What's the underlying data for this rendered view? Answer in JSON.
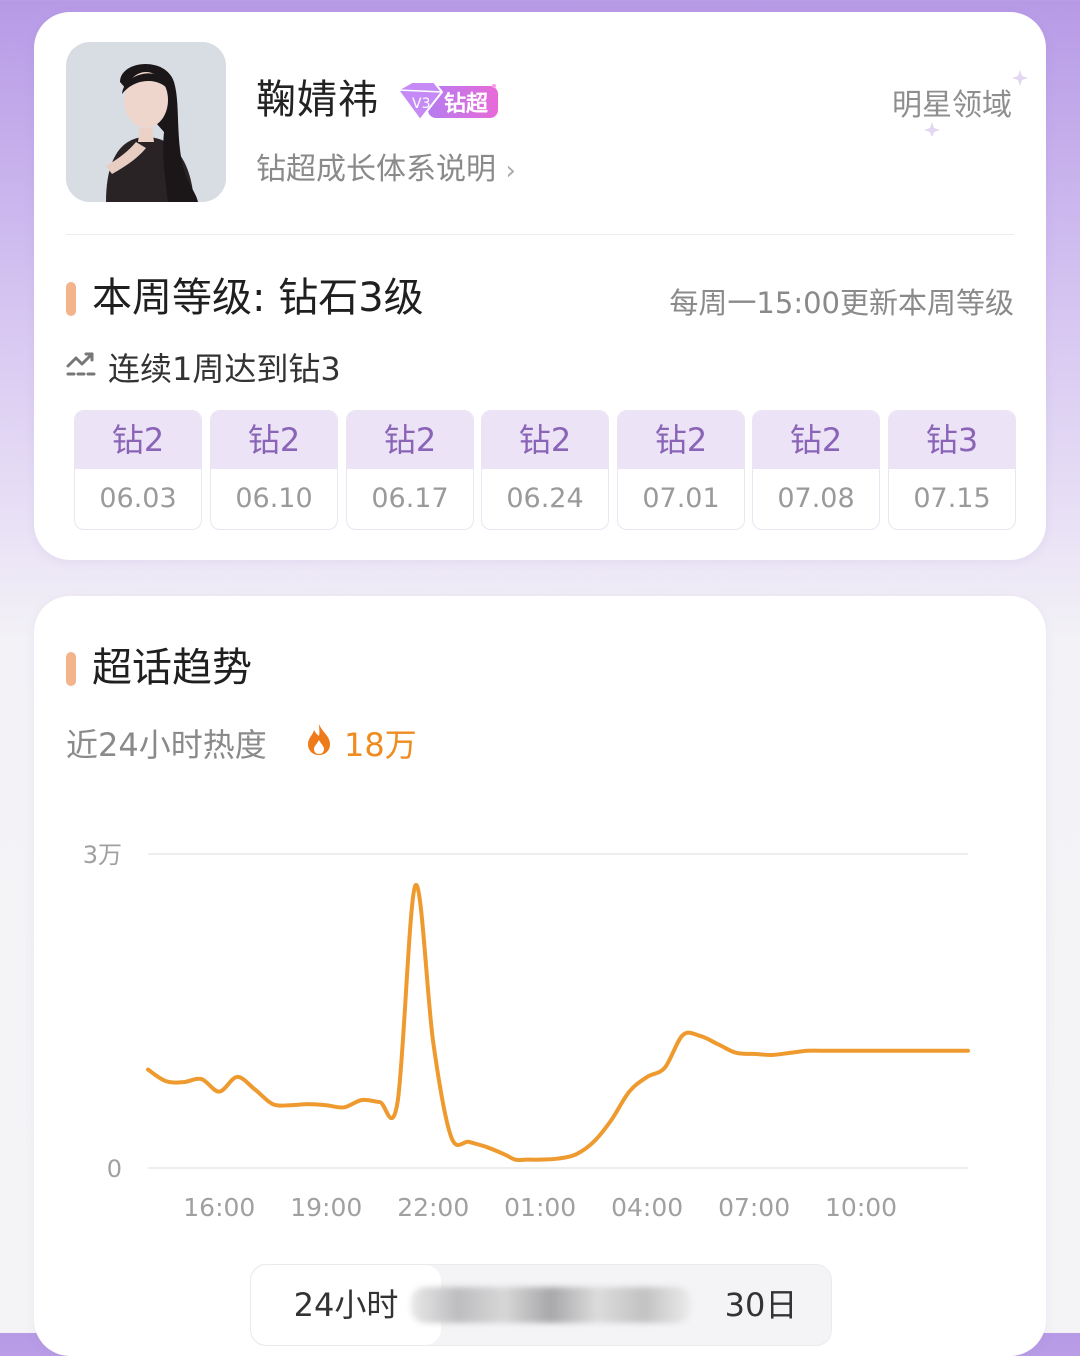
{
  "profile": {
    "name": "鞠婧祎",
    "badge": "钻超",
    "growth_link": "钻超成长体系说明",
    "domain_tag": "明星领域"
  },
  "level": {
    "title": "本周等级: 钻石3级",
    "update_note": "每周一15:00更新本周等级",
    "streak": "连续1周达到钻3",
    "weeks": [
      {
        "level": "钻2",
        "date": "06.03"
      },
      {
        "level": "钻2",
        "date": "06.10"
      },
      {
        "level": "钻2",
        "date": "06.17"
      },
      {
        "level": "钻2",
        "date": "06.24"
      },
      {
        "level": "钻2",
        "date": "07.01"
      },
      {
        "level": "钻2",
        "date": "07.08"
      },
      {
        "level": "钻3",
        "date": "07.15"
      }
    ]
  },
  "trend": {
    "title": "超话趋势",
    "heat_label": "近24小时热度",
    "heat_value": "18万"
  },
  "chart_data": {
    "type": "line",
    "y_tick_labels": [
      "0",
      "3万"
    ],
    "ylim": [
      0,
      30000
    ],
    "x_tick_labels": [
      "16:00",
      "19:00",
      "22:00",
      "01:00",
      "04:00",
      "07:00",
      "10:00"
    ],
    "x_hours": [
      14,
      14.5,
      15,
      15.5,
      16,
      16.5,
      17,
      17.5,
      18,
      18.5,
      19,
      19.5,
      20,
      20.5,
      21,
      21.5,
      22,
      22.5,
      23,
      23.5,
      24,
      24.3,
      24.6,
      25,
      25.5,
      26,
      26.5,
      27,
      27.5,
      28,
      28.5,
      29,
      29.5,
      30,
      30.5,
      31,
      31.5,
      32,
      32.5,
      33,
      33.5,
      34,
      34.5,
      35,
      35.5,
      36,
      36.5,
      37
    ],
    "values": [
      9400,
      8300,
      8200,
      8500,
      7300,
      8700,
      7500,
      6100,
      6000,
      6100,
      6000,
      5800,
      6500,
      6300,
      6300,
      27000,
      12000,
      3000,
      2500,
      2000,
      1300,
      800,
      800,
      800,
      900,
      1300,
      2500,
      4600,
      7300,
      8700,
      9600,
      12700,
      12600,
      11800,
      11000,
      10900,
      10800,
      11000,
      11200,
      11200,
      11200,
      11200,
      11200,
      11200,
      11200,
      11200,
      11200,
      11200
    ],
    "color": "#ee9a2e",
    "grid": true
  },
  "range_tabs": {
    "active": "24小时",
    "last": "30日"
  },
  "colors": {
    "accent_bar": "#f4b48b",
    "heat_orange": "#ef8b1f",
    "week_level_bg": "#ece3f7",
    "week_level_text": "#8a64b6"
  }
}
